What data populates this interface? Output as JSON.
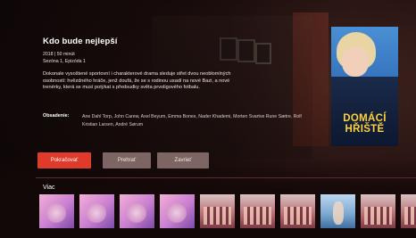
{
  "detail": {
    "title": "Kdo bude nejlepší",
    "meta_line1": "2018 | 50 minút",
    "meta_line2": "Sezóna 1, Epizóda 1",
    "description": "Dokonale vysoštené sportovní i charakterové drama sleduje střet dvou neobloml­ných osobností: hvězdného hráče, jenž doufá, že se s rodinou usadí na nové Bazi, a nové trenérky, která se musí potýkat s předsudky světa prvoligového fotbalu.",
    "cast_label": "Obsadenie:",
    "cast_text": "Ane Dahl Torp, John Carew, Axel Beyum, Emma Bones, Nader Khademi, Morten Svartve Rune Sætre, Rolf Kristian Larsen, André Sørum"
  },
  "buttons": {
    "play": "Pokračovať",
    "trailer": "Prehrať",
    "close": "Zavrieť"
  },
  "poster": {
    "title_line1": "DOMÁCÍ",
    "title_line2": "HŘIŠTĚ"
  },
  "more": {
    "section_title": "Viac",
    "thumbnails": [
      {
        "style": "pink"
      },
      {
        "style": "pink"
      },
      {
        "style": "pink"
      },
      {
        "style": "pink"
      },
      {
        "style": "group"
      },
      {
        "style": "group"
      },
      {
        "style": "group"
      },
      {
        "style": "blue"
      },
      {
        "style": "group"
      },
      {
        "style": "group"
      }
    ]
  },
  "colors": {
    "accent": "#e03a2a",
    "button_secondary": "#7d6563",
    "poster_title": "#ffd23a"
  }
}
